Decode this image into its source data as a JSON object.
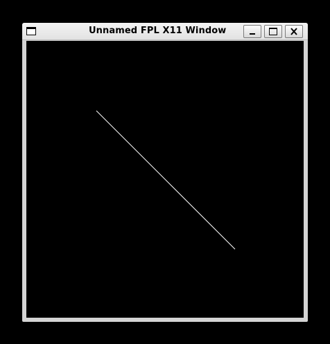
{
  "window": {
    "title": "Unnamed FPL X11 Window"
  },
  "titlebar_icons": {
    "app": "window-icon",
    "minimize": "minimize-icon",
    "maximize": "maximize-icon",
    "close": "close-icon"
  },
  "canvas": {
    "background": "#000000",
    "stroke": "#ffffff"
  }
}
